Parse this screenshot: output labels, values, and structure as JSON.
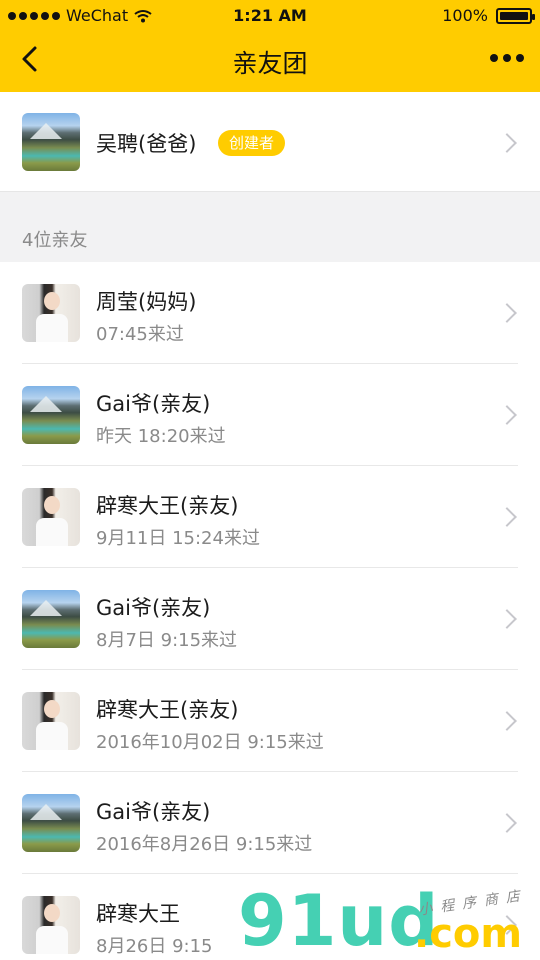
{
  "status_bar": {
    "carrier": "WeChat",
    "time": "1:21 AM",
    "battery": "100%"
  },
  "nav": {
    "title": "亲友团",
    "back_icon": "chevron-left-icon",
    "more_icon": "more-dots-icon"
  },
  "creator": {
    "name": "吴聘(爸爸)",
    "badge": "创建者",
    "avatar": "mountain"
  },
  "section": {
    "title": "4位亲友"
  },
  "members": [
    {
      "name": "周莹(妈妈)",
      "time": "07:45来过",
      "avatar": "girl"
    },
    {
      "name": "Gai爷(亲友)",
      "time": "昨天 18:20来过",
      "avatar": "mountain"
    },
    {
      "name": "辟寒大王(亲友)",
      "time": "9月11日 15:24来过",
      "avatar": "girl"
    },
    {
      "name": "Gai爷(亲友)",
      "time": "8月7日 9:15来过",
      "avatar": "mountain"
    },
    {
      "name": "辟寒大王(亲友)",
      "time": "2016年10月02日 9:15来过",
      "avatar": "girl"
    },
    {
      "name": "Gai爷(亲友)",
      "time": "2016年8月26日 9:15来过",
      "avatar": "mountain"
    },
    {
      "name": "辟寒大王",
      "time": "8月26日 9:15",
      "avatar": "girl"
    }
  ],
  "watermark": {
    "main": "91ud",
    "suffix": ".com",
    "tagline": "小程序商店"
  },
  "colors": {
    "accent": "#ffcc00",
    "badge_text": "#ffffff",
    "secondary_text": "#8a8a8a",
    "background": "#f2f2f3",
    "watermark_green": "#45d0b3"
  }
}
